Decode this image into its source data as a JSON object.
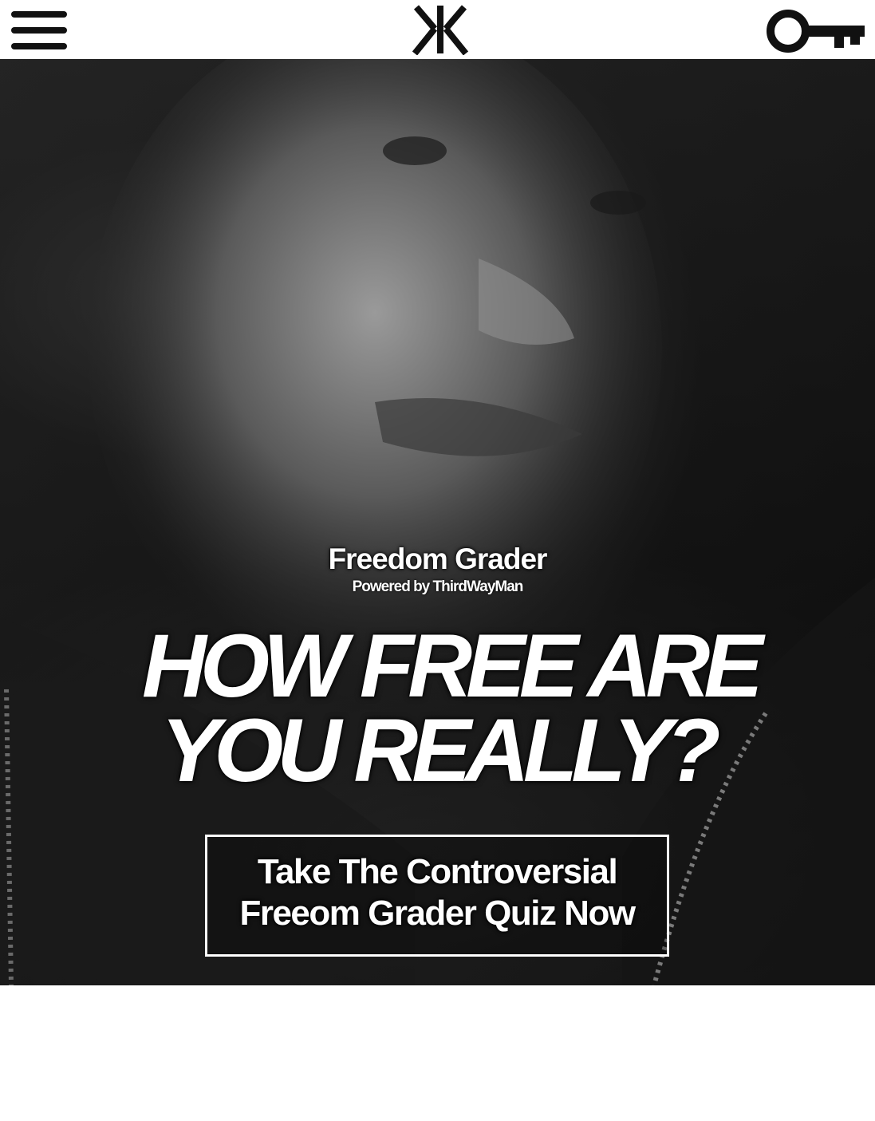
{
  "header": {
    "menu_icon": "hamburger-menu-icon",
    "logo_icon": "zhe-cyrillic-logo",
    "key_icon": "key-icon"
  },
  "hero": {
    "image": "black-and-white portrait photo",
    "brand_title": "Freedom Grader",
    "brand_subtitle": "Powered by ThirdWayMan",
    "headline_line1": "HOW FREE ARE",
    "headline_line2": "YOU REALLY?",
    "cta_line1": "Take The Controversial",
    "cta_line2": "Freeom Grader Quiz Now"
  },
  "colors": {
    "header_bg": "#ffffff",
    "icon": "#111111",
    "hero_text": "#ffffff",
    "page_bg": "#ffffff"
  }
}
